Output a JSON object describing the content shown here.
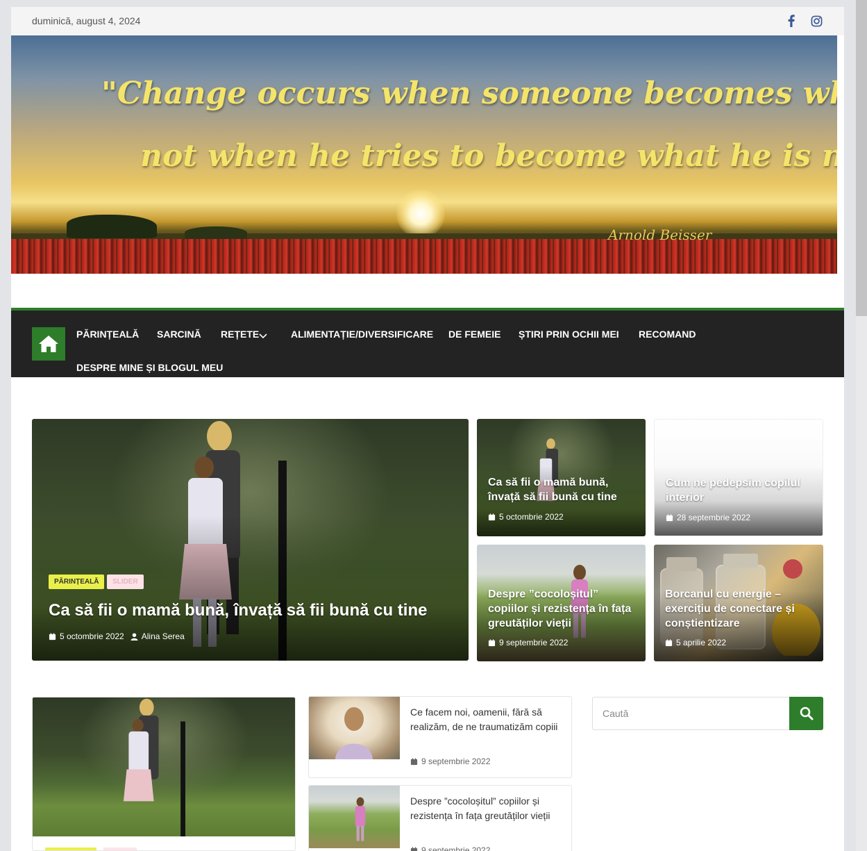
{
  "topbar": {
    "date": "duminică, august 4, 2024",
    "social": [
      {
        "icon": "facebook-icon",
        "glyph": "f"
      },
      {
        "icon": "instagram-icon"
      }
    ]
  },
  "banner": {
    "quote_line1": "\"Change occurs when someone becomes who he is,",
    "quote_line2": "not when he tries to become what he is not \"",
    "author": "Arnold Beisser"
  },
  "nav": {
    "home_icon": "home-icon",
    "items": [
      {
        "label": "PĂRINȚEALĂ"
      },
      {
        "label": "SARCINĂ"
      },
      {
        "label": "REȚETE",
        "has_dropdown": true
      },
      {
        "label": "ALIMENTAȚIE/DIVERSIFICARE"
      },
      {
        "label": "DE FEMEIE"
      },
      {
        "label": "ȘTIRI PRIN OCHII MEI"
      },
      {
        "label": "RECOMAND"
      },
      {
        "label": "DESPRE MINE ȘI BLOGUL MEU"
      }
    ]
  },
  "featured": {
    "main": {
      "badges": [
        "PĂRINȚEALĂ",
        "SLIDER"
      ],
      "title": "Ca să fii o mamă bună, învață să fii bună cu tine",
      "date": "5 octombrie 2022",
      "author": "Alina Serea"
    },
    "side": [
      {
        "title": "Ca să fii o mamă bună, învață să fii bună cu tine",
        "date": "5 octombrie 2022"
      },
      {
        "title": "Cum ne pedepsim copilul interior",
        "date": "28 septembrie 2022"
      },
      {
        "title": "Despre ”cocoloșitul” copiilor și rezistența în fața greutăților vieții",
        "date": "9 septembrie 2022"
      },
      {
        "title": "Borcanul cu energie – exercițiu de conectare și conștientizare",
        "date": "5 aprilie 2022"
      }
    ]
  },
  "list": [
    {
      "title": "Ce facem noi, oamenii, fără să realizăm, de ne traumatizăm copiii",
      "date": "9 septembrie 2022"
    },
    {
      "title": "Despre ”cocoloșitul” copiilor și rezistența în fața greutăților vieții",
      "date": "9 septembrie 2022"
    }
  ],
  "search": {
    "placeholder": "Caută",
    "icon": "search-icon"
  },
  "colors": {
    "accent": "#2d7d2a",
    "nav_bg": "#232323",
    "badge_yellow": "#eaf04a",
    "badge_pink": "#fde3e8"
  }
}
